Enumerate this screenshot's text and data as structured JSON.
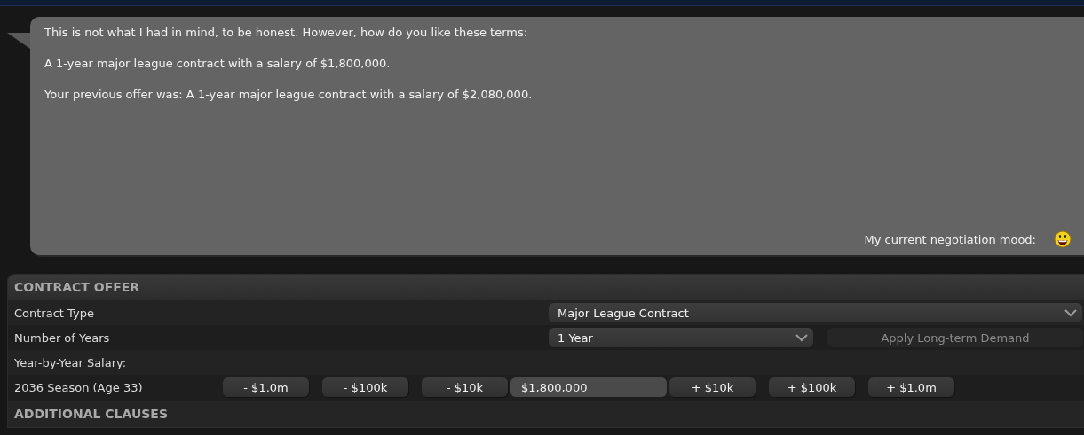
{
  "message": {
    "paragraphs": [
      "This is not what I had in mind, to be honest. However, how do you like these terms:",
      "A 1-year major league contract with a salary of $1,800,000.",
      "Your previous offer was: A 1-year major league contract with a salary of $2,080,000."
    ],
    "mood_label": "My current negotiation mood:"
  },
  "contract_offer": {
    "title": "CONTRACT OFFER",
    "contract_type": {
      "label": "Contract Type",
      "value": "Major League Contract"
    },
    "number_of_years": {
      "label": "Number of Years",
      "value": "1 Year",
      "apply_button": {
        "label": "Apply Long-term Demand",
        "disabled": true
      }
    },
    "salary_heading": "Year-by-Year Salary:",
    "seasons": [
      {
        "label": "2036 Season (Age 33)",
        "decrease_buttons": [
          "- $1.0m",
          "- $100k",
          "- $10k"
        ],
        "salary": "$1,800,000",
        "increase_buttons": [
          "+ $10k",
          "+ $100k",
          "+ $1.0m"
        ]
      }
    ]
  },
  "additional_clauses": {
    "title": "ADDITIONAL CLAUSES"
  }
}
